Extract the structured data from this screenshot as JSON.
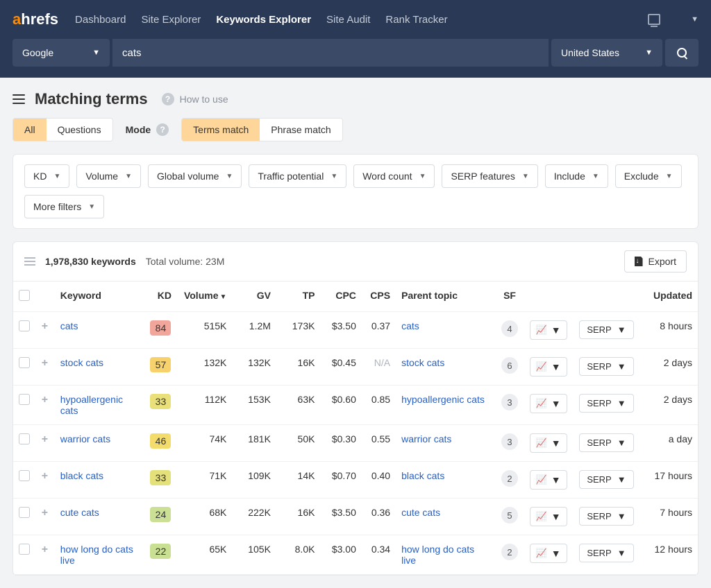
{
  "nav": {
    "links": [
      "Dashboard",
      "Site Explorer",
      "Keywords Explorer",
      "Site Audit",
      "Rank Tracker"
    ],
    "active": "Keywords Explorer"
  },
  "search": {
    "engine": "Google",
    "query": "cats",
    "country": "United States"
  },
  "page": {
    "title": "Matching terms",
    "howto": "How to use"
  },
  "tabs": {
    "view": {
      "options": [
        "All",
        "Questions"
      ],
      "active": "All"
    },
    "mode_label": "Mode",
    "mode": {
      "options": [
        "Terms match",
        "Phrase match"
      ],
      "active": "Terms match"
    }
  },
  "filters": [
    "KD",
    "Volume",
    "Global volume",
    "Traffic potential",
    "Word count",
    "SERP features",
    "Include",
    "Exclude",
    "More filters"
  ],
  "summary": {
    "keyword_count": "1,978,830 keywords",
    "total_volume": "Total volume: 23M",
    "export": "Export"
  },
  "columns": {
    "keyword": "Keyword",
    "kd": "KD",
    "volume": "Volume",
    "gv": "GV",
    "tp": "TP",
    "cpc": "CPC",
    "cps": "CPS",
    "parent": "Parent topic",
    "sf": "SF",
    "updated": "Updated",
    "serp": "SERP"
  },
  "rows": [
    {
      "keyword": "cats",
      "kd": 84,
      "kd_color": "#f2a59b",
      "volume": "515K",
      "gv": "1.2M",
      "tp": "173K",
      "cpc": "$3.50",
      "cps": "0.37",
      "parent": "cats",
      "sf": 4,
      "updated": "8 hours"
    },
    {
      "keyword": "stock cats",
      "kd": 57,
      "kd_color": "#f7d26c",
      "volume": "132K",
      "gv": "132K",
      "tp": "16K",
      "cpc": "$0.45",
      "cps": "N/A",
      "parent": "stock cats",
      "sf": 6,
      "updated": "2 days"
    },
    {
      "keyword": "hypoallergenic cats",
      "kd": 33,
      "kd_color": "#e9e079",
      "volume": "112K",
      "gv": "153K",
      "tp": "63K",
      "cpc": "$0.60",
      "cps": "0.85",
      "parent": "hypoallergenic cats",
      "sf": 3,
      "updated": "2 days"
    },
    {
      "keyword": "warrior cats",
      "kd": 46,
      "kd_color": "#f3dc6b",
      "volume": "74K",
      "gv": "181K",
      "tp": "50K",
      "cpc": "$0.30",
      "cps": "0.55",
      "parent": "warrior cats",
      "sf": 3,
      "updated": "a day"
    },
    {
      "keyword": "black cats",
      "kd": 33,
      "kd_color": "#e4e07a",
      "volume": "71K",
      "gv": "109K",
      "tp": "14K",
      "cpc": "$0.70",
      "cps": "0.40",
      "parent": "black cats",
      "sf": 2,
      "updated": "17 hours"
    },
    {
      "keyword": "cute cats",
      "kd": 24,
      "kd_color": "#cce095",
      "volume": "68K",
      "gv": "222K",
      "tp": "16K",
      "cpc": "$3.50",
      "cps": "0.36",
      "parent": "cute cats",
      "sf": 5,
      "updated": "7 hours"
    },
    {
      "keyword": "how long do cats live",
      "kd": 22,
      "kd_color": "#c9e093",
      "volume": "65K",
      "gv": "105K",
      "tp": "8.0K",
      "cpc": "$3.00",
      "cps": "0.34",
      "parent": "how long do cats live",
      "sf": 2,
      "updated": "12 hours"
    }
  ]
}
